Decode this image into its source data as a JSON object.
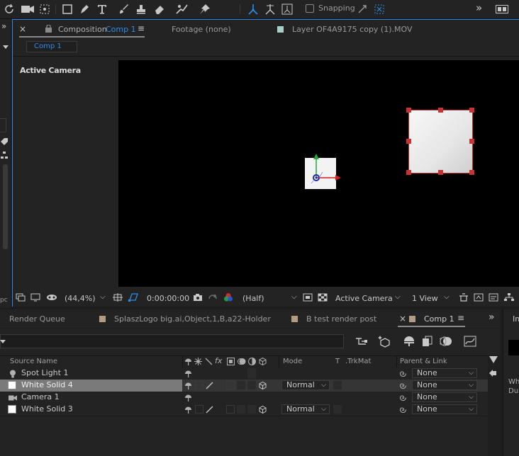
{
  "toolbar": {
    "snapping_label": "Snapping",
    "more": "»"
  },
  "comp_panel": {
    "tab_close": "×",
    "tab_prefix": "Composition",
    "tab_name": "Comp 1",
    "tab_menu": "≡",
    "footage_tab": "Footage  (none)",
    "layer_tab": "Layer  OF4A9175 copy (1).MOV",
    "comp_breadcrumb": "Comp 1",
    "viewer_label": "Active Camera"
  },
  "viewer_footer": {
    "zoom": "(44,4%)",
    "timecode": "0:00:00:00",
    "resolution": "(Half)",
    "camera": "Active Camera",
    "views": "1 View"
  },
  "left_panel": {
    "collapse": "»",
    "label_fragment": "pc"
  },
  "bottom_tabs": {
    "render_queue": "Render Queue",
    "tab2": "SplaszLogo big.ai,Object,1,B,a22-Holder",
    "tab3": "B test render post",
    "tab4_close": "×",
    "tab4": "Comp 1",
    "tab4_menu": "≡",
    "more": "»"
  },
  "timeline": {
    "columns": {
      "source_name": "Source Name",
      "mode": "Mode",
      "t": "T",
      "trkmat": ".TrkMat",
      "parent": "Parent & Link"
    },
    "layers": [
      {
        "name": "Spot Light 1",
        "icon": "light-icon",
        "mode": "",
        "parent": "None",
        "selected": false
      },
      {
        "name": "White Solid 4",
        "icon": "white-swatch",
        "mode": "Normal",
        "parent": "None",
        "selected": true
      },
      {
        "name": "Camera 1",
        "icon": "camera-icon",
        "mode": "",
        "parent": "None",
        "selected": false
      },
      {
        "name": "White Solid 3",
        "icon": "white-swatch",
        "mode": "Normal",
        "parent": "None",
        "selected": false
      }
    ]
  },
  "right_panel": {
    "top": "Im",
    "line1": "Whi",
    "line2": "Du"
  },
  "colors": {
    "accent_blue": "#2d8ceb",
    "selection_red": "#c83232",
    "panel_bg": "#232323",
    "viewer_bg": "#000000"
  }
}
